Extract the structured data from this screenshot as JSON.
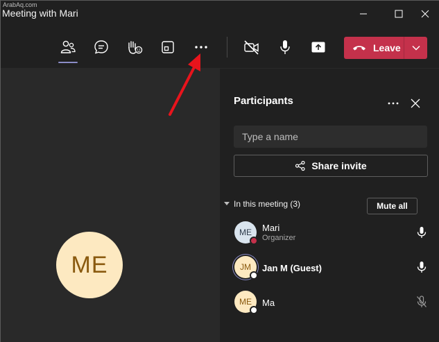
{
  "watermark": "ArabAq.com",
  "window": {
    "title": "Meeting with Mari"
  },
  "icons": {
    "people": "people-icon",
    "chat": "chat-icon",
    "reactions": "raise-hand-icon",
    "rooms": "breakout-rooms-icon",
    "more": "more-icon",
    "camera": "camera-off-icon",
    "mic": "microphone-icon",
    "share": "share-screen-icon",
    "hangup": "hang-up-icon"
  },
  "toolbar": {
    "leave_label": "Leave"
  },
  "stage": {
    "self_initials": "ME"
  },
  "participants": {
    "title": "Participants",
    "search_placeholder": "Type a name",
    "share_invite_label": "Share invite",
    "section_label": "In this meeting (3)",
    "mute_all_label": "Mute all",
    "list": [
      {
        "initials": "ME",
        "name": "Mari",
        "role": "Organizer",
        "status": "busy",
        "mic": "on"
      },
      {
        "initials": "JM",
        "name": "Jan M (Guest)",
        "role": "",
        "status": "unknown",
        "mic": "on"
      },
      {
        "initials": "ME",
        "name": "Ma",
        "role": "",
        "status": "unknown",
        "mic": "muted"
      }
    ]
  },
  "colors": {
    "leave": "#c4314b",
    "accent": "#8b8cc7",
    "busy": "#c4314b"
  }
}
